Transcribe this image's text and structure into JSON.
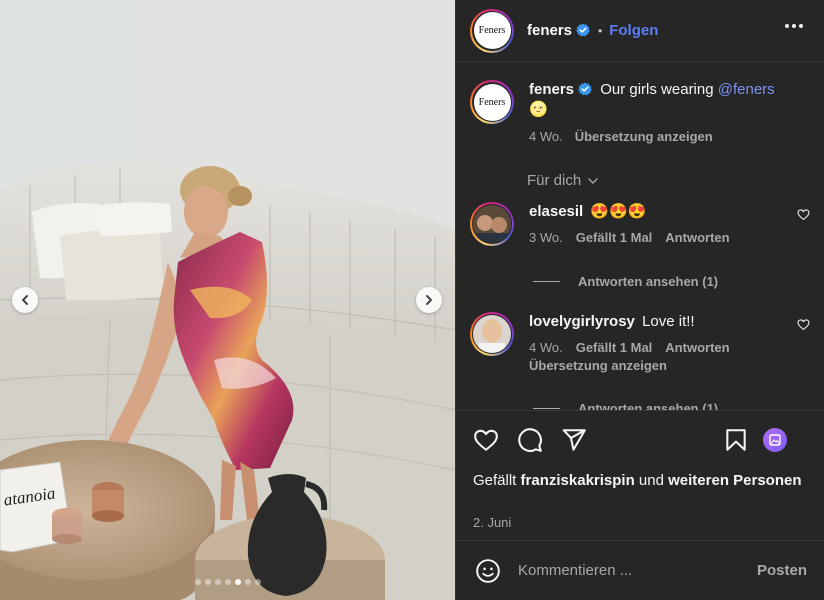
{
  "carousel": {
    "prev_icon": "chevron-left-icon",
    "next_icon": "chevron-right-icon",
    "slide_count": 7,
    "active_slide": 5,
    "magazine_text": "atanoia"
  },
  "header": {
    "avatar_text": "Feners",
    "username": "feners",
    "separator": "•",
    "follow_label": "Folgen"
  },
  "caption": {
    "username": "feners",
    "text_before": "Our girls wearing ",
    "mention": "@feners",
    "emoji": "🌝",
    "time": "4 Wo.",
    "translate_label": "Übersetzung anzeigen"
  },
  "filter": {
    "label": "Für dich"
  },
  "comments": [
    {
      "username": "elasesil",
      "text": "😍😍😍",
      "time": "3 Wo.",
      "likes_label": "Gefällt 1 Mal",
      "reply_label": "Antworten",
      "replies_label": "Antworten ansehen (1)"
    },
    {
      "username": "lovelygirlyrosy",
      "text": "Love it!!",
      "time": "4 Wo.",
      "likes_label": "Gefällt 1 Mal",
      "reply_label": "Antworten",
      "translate_label": "Übersetzung anzeigen",
      "replies_label": "Antworten ansehen (1)"
    }
  ],
  "likes": {
    "prefix": "Gefällt ",
    "user": "franziskakrispin",
    "middle": " und ",
    "others": "weiteren Personen"
  },
  "post_date": "2. Juni",
  "comment_box": {
    "placeholder": "Kommentieren ...",
    "post_label": "Posten"
  },
  "colors": {
    "panel_bg": "#262626",
    "accent_blue": "#5b7df5",
    "mention_blue": "#7b93f6",
    "muted_text": "#a8a8a8",
    "verified_blue": "#3897f0"
  }
}
